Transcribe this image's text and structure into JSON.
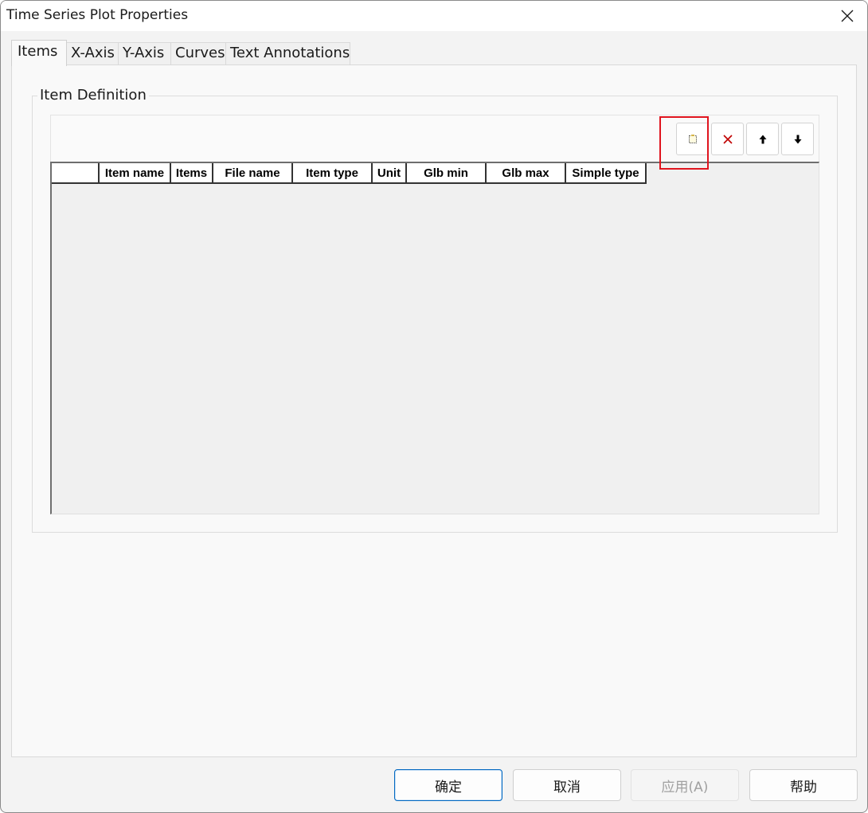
{
  "window": {
    "title": "Time Series Plot Properties"
  },
  "tabs": [
    {
      "label": "Items",
      "active": true
    },
    {
      "label": "X-Axis"
    },
    {
      "label": "Y-Axis"
    },
    {
      "label": "Curves"
    },
    {
      "label": "Text Annotations"
    }
  ],
  "item_definition": {
    "legend": "Item Definition",
    "toolbar": [
      {
        "icon": "new-item-icon",
        "highlighted": true
      },
      {
        "icon": "delete-icon",
        "color": "#c00000"
      },
      {
        "icon": "arrow-up-icon"
      },
      {
        "icon": "arrow-down-icon"
      }
    ],
    "columns": [
      "",
      "Item name",
      "Items",
      "File name",
      "Item type",
      "Unit",
      "Glb min",
      "Glb max",
      "Simple type"
    ],
    "rows": []
  },
  "footer": {
    "ok_label": "确定",
    "cancel_label": "取消",
    "apply_label": "应用(A)",
    "help_label": "帮助"
  },
  "colors": {
    "highlight": "#e0141e",
    "primary_border": "#0067c0"
  }
}
